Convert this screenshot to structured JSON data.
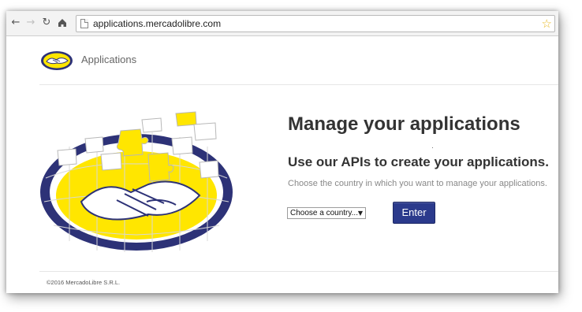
{
  "browser": {
    "url": "applications.mercadolibre.com",
    "icons": {
      "back": "back-arrow-icon",
      "forward": "forward-arrow-icon",
      "reload": "reload-icon",
      "home": "home-icon",
      "page": "page-icon",
      "bookmark": "star-icon"
    }
  },
  "header": {
    "title": "Applications",
    "logo": "mercadolibre-handshake-logo"
  },
  "main": {
    "title": "Manage your applications",
    "subtitle": "Use our APIs to create your applications.",
    "hint": "Choose the country in which you want to manage your applications.",
    "country_select": {
      "selected": "Choose a country..."
    },
    "enter_label": "Enter",
    "hero_image": "handshake-puzzle-illustration"
  },
  "footer": {
    "copyright": "©2016 MercadoLibre S.R.L."
  },
  "colors": {
    "brand_yellow": "#ffe600",
    "brand_blue": "#2d3277",
    "button_blue": "#2b3a8c"
  }
}
